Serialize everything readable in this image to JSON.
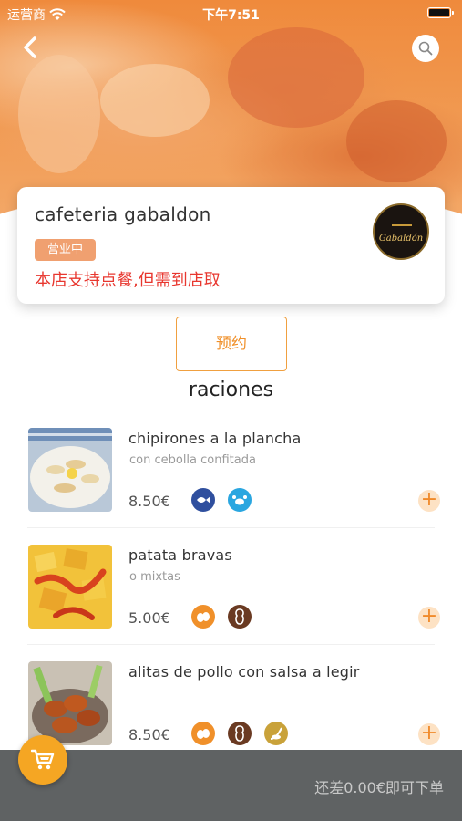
{
  "status_bar": {
    "carrier": "运营商",
    "time": "下午7:51"
  },
  "header": {
    "back_icon": "chevron-left-icon",
    "search_icon": "search-icon"
  },
  "store": {
    "name": "cafeteria gabaldon",
    "status_badge": "营业中",
    "notice": "本店支持点餐,但需到店取",
    "logo_text": "Gabaldón"
  },
  "reserve_button": "预约",
  "section_title": "raciones",
  "colors": {
    "accent": "#f0902a",
    "notice_red": "#e8372f",
    "badge": "#f0a070",
    "cart_bar": "#5f6263",
    "cart_fab": "#f5a623"
  },
  "menu_items": [
    {
      "name": "chipirones a la plancha",
      "description": "con cebolla confitada",
      "price": "8.50€",
      "allergens": [
        "fish-icon",
        "crustacean-icon"
      ]
    },
    {
      "name": "patata bravas",
      "description": "o mixtas",
      "price": "5.00€",
      "allergens": [
        "eggs-icon",
        "peanut-icon"
      ]
    },
    {
      "name": "alitas de pollo con salsa a legir",
      "description": "",
      "price": "8.50€",
      "allergens": [
        "eggs-icon",
        "peanut-icon",
        "mustard-icon"
      ]
    }
  ],
  "cart": {
    "note": "还差0.00€即可下单",
    "icon": "cart-icon"
  }
}
